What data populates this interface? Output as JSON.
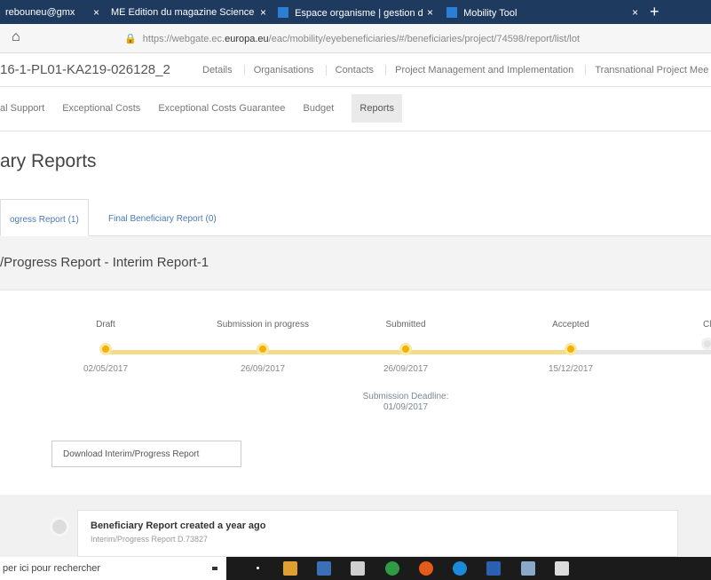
{
  "browser": {
    "tabs": [
      {
        "label": "rebouneu@gmx"
      },
      {
        "label": "ME Edition du magazine Science"
      },
      {
        "label": "Espace organisme | gestion d"
      },
      {
        "label": "Mobility Tool"
      }
    ],
    "new_tab": "+",
    "url_prefix": "https://webgate.ec.",
    "url_domain": "europa.eu",
    "url_rest": "/eac/mobility/eyebeneficiaries/#/beneficiaries/project/74598/report/list/lot"
  },
  "app": {
    "project_code": "16-1-PL01-KA219-026128_2",
    "nav": [
      "Details",
      "Organisations",
      "Contacts",
      "Project Management and Implementation",
      "Transnational Project Mee"
    ],
    "subnav": [
      "al Support",
      "Exceptional Costs",
      "Exceptional Costs Guarantee",
      "Budget",
      "Reports"
    ],
    "subnav_active": "Reports",
    "page_title": "ary Reports",
    "report_tabs": [
      {
        "label": "ogress Report (1)",
        "active": true
      },
      {
        "label": "Final Beneficiary Report (0)",
        "active": false
      }
    ],
    "section_title": "/Progress Report - Interim Report-1",
    "timeline": [
      {
        "label": "Draft",
        "date": "02/05/2017",
        "done": true
      },
      {
        "label": "Submission in progress",
        "date": "26/09/2017",
        "done": true
      },
      {
        "label": "Submitted",
        "date": "26/09/2017",
        "done": true
      },
      {
        "label": "Accepted",
        "date": "15/12/2017",
        "done": true
      },
      {
        "label": "Cl",
        "date": "",
        "done": false
      }
    ],
    "deadline_label": "Submission Deadline:",
    "deadline_date": "01/09/2017",
    "download_button": "Download Interim/Progress Report",
    "activity_title": "Beneficiary Report created a year ago",
    "activity_sub": "Interim/Progress Report D.73827"
  },
  "taskbar": {
    "search_text": "per ici pour rechercher"
  },
  "colors": {
    "accent": "#f2b200",
    "link": "#4a78b5",
    "tabbar": "#1f3a5f"
  }
}
